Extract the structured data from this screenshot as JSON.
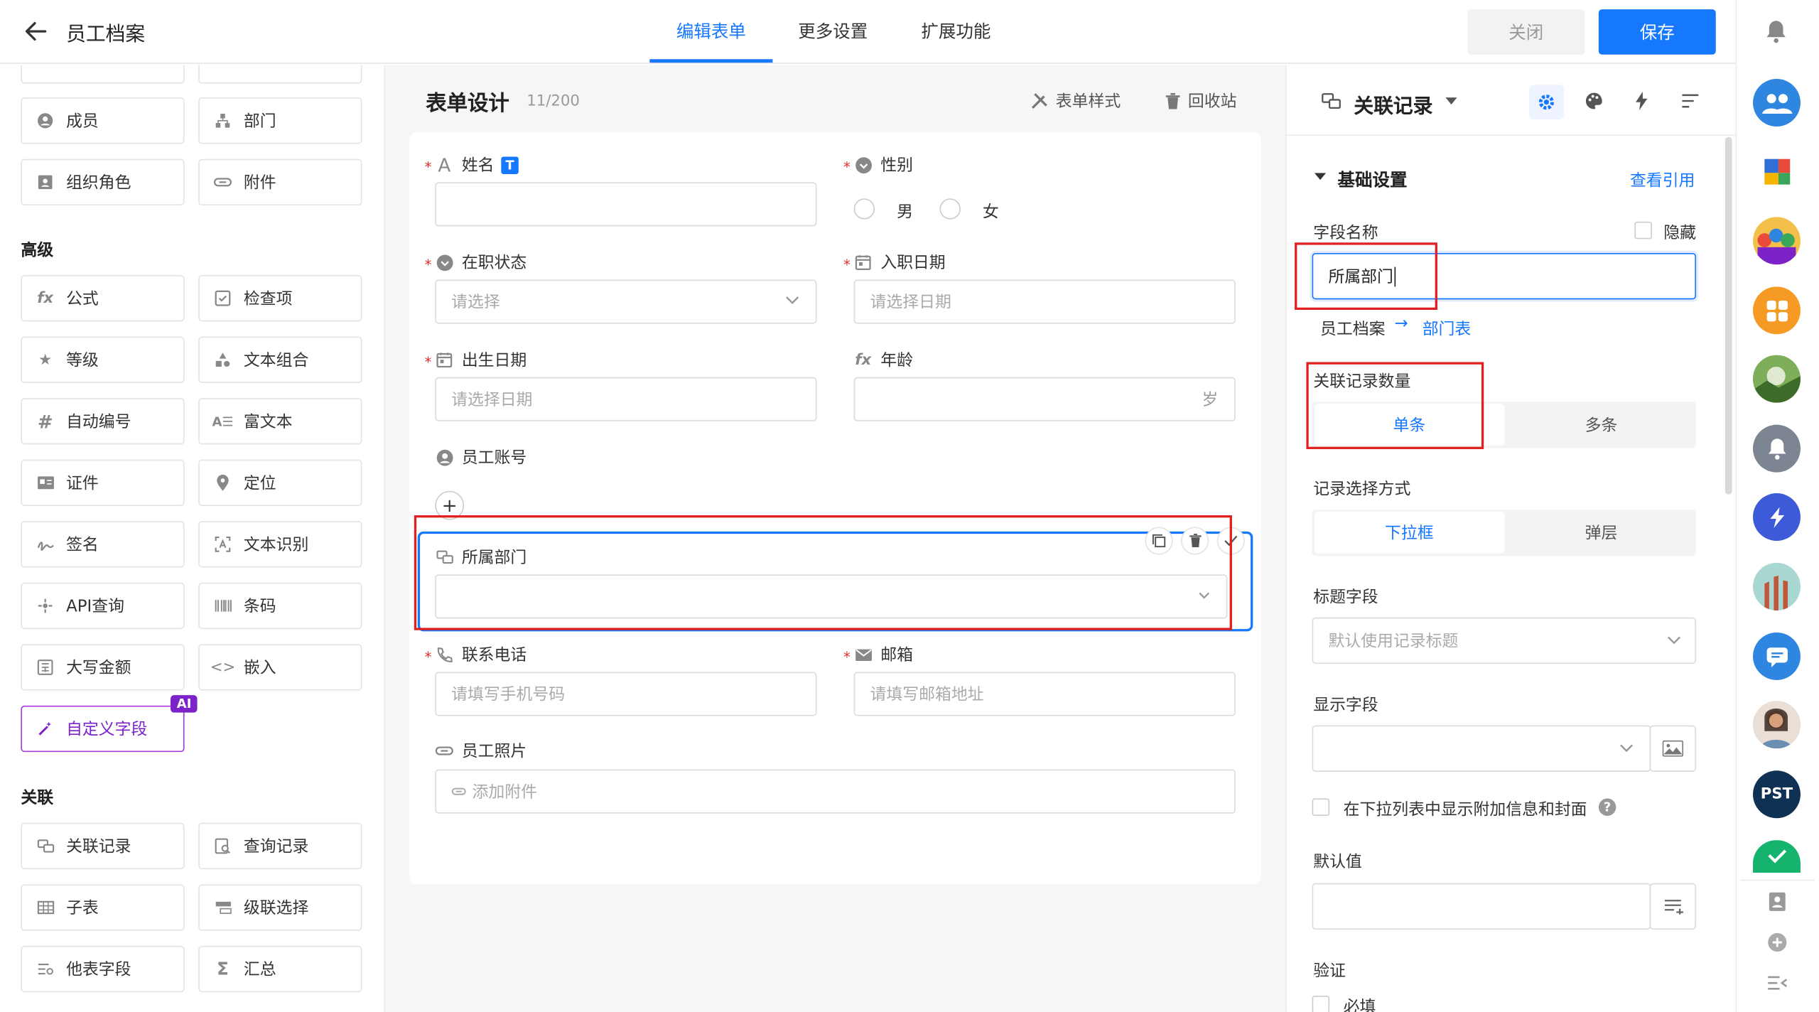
{
  "header": {
    "title": "员工档案",
    "tabs": [
      "编辑表单",
      "更多设置",
      "扩展功能"
    ],
    "close_label": "关闭",
    "save_label": "保存"
  },
  "left": {
    "basic_fields": [
      {
        "label": "成员",
        "icon": "user-circle-icon"
      },
      {
        "label": "部门",
        "icon": "org-tree-icon"
      },
      {
        "label": "组织角色",
        "icon": "id-badge-icon"
      },
      {
        "label": "附件",
        "icon": "paperclip-icon"
      }
    ],
    "advanced_title": "高级",
    "advanced_fields": [
      {
        "label": "公式",
        "icon": "fx-icon"
      },
      {
        "label": "检查项",
        "icon": "checkbox-icon"
      },
      {
        "label": "等级",
        "icon": "star-icon"
      },
      {
        "label": "文本组合",
        "icon": "shapes-icon"
      },
      {
        "label": "自动编号",
        "icon": "hash-icon"
      },
      {
        "label": "富文本",
        "icon": "rich-text-icon"
      },
      {
        "label": "证件",
        "icon": "id-card-icon"
      },
      {
        "label": "定位",
        "icon": "location-pin-icon"
      },
      {
        "label": "签名",
        "icon": "signature-icon"
      },
      {
        "label": "文本识别",
        "icon": "ocr-scan-icon"
      },
      {
        "label": "API查询",
        "icon": "api-icon"
      },
      {
        "label": "条码",
        "icon": "barcode-icon"
      },
      {
        "label": "大写金额",
        "icon": "amount-icon"
      },
      {
        "label": "嵌入",
        "icon": "code-embed-icon"
      }
    ],
    "custom_field": {
      "label": "自定义字段",
      "badge": "AI",
      "icon": "magic-wand-icon"
    },
    "relation_title": "关联",
    "relation_fields": [
      {
        "label": "关联记录",
        "icon": "link-record-icon"
      },
      {
        "label": "查询记录",
        "icon": "query-record-icon"
      },
      {
        "label": "子表",
        "icon": "table-icon"
      },
      {
        "label": "级联选择",
        "icon": "cascade-icon"
      },
      {
        "label": "他表字段",
        "icon": "other-field-icon"
      },
      {
        "label": "汇总",
        "icon": "sigma-icon"
      }
    ]
  },
  "center": {
    "title": "表单设计",
    "count": "11/200",
    "tool_style": "表单样式",
    "tool_recycle": "回收站",
    "fields": {
      "name": {
        "label": "姓名",
        "badge": "T"
      },
      "gender": {
        "label": "性别",
        "options": [
          "男",
          "女"
        ]
      },
      "status": {
        "label": "在职状态",
        "placeholder": "请选择"
      },
      "hire_date": {
        "label": "入职日期",
        "placeholder": "请选择日期"
      },
      "birth": {
        "label": "出生日期",
        "placeholder": "请选择日期"
      },
      "age": {
        "label": "年龄",
        "unit": "岁"
      },
      "account": {
        "label": "员工账号"
      },
      "dept": {
        "label": "所属部门"
      },
      "phone": {
        "label": "联系电话",
        "placeholder": "请填写手机号码"
      },
      "email": {
        "label": "邮箱",
        "placeholder": "请填写邮箱地址"
      },
      "photo": {
        "label": "员工照片",
        "placeholder": "添加附件"
      }
    },
    "add_symbol": "+"
  },
  "right": {
    "title": "关联记录",
    "section": "基础设置",
    "view_ref": "查看引用",
    "field_name_label": "字段名称",
    "hidden_label": "隐藏",
    "field_name_value": "所属部门",
    "relation_from": "员工档案",
    "relation_arrow": "→",
    "relation_to": "部门表",
    "count_label": "关联记录数量",
    "count_options": [
      "单条",
      "多条"
    ],
    "select_label": "记录选择方式",
    "select_options": [
      "下拉框",
      "弹层"
    ],
    "title_field_label": "标题字段",
    "title_field_placeholder": "默认使用记录标题",
    "display_field_label": "显示字段",
    "extra_info_label": "在下拉列表中显示附加信息和封面",
    "default_label": "默认值",
    "validate_label": "验证",
    "required_label": "必填"
  },
  "sidebar_right": {
    "pst_label": "PST"
  },
  "colors": {
    "accent": "#1677ff",
    "danger": "#e02020",
    "ai": "#7b22c9"
  }
}
